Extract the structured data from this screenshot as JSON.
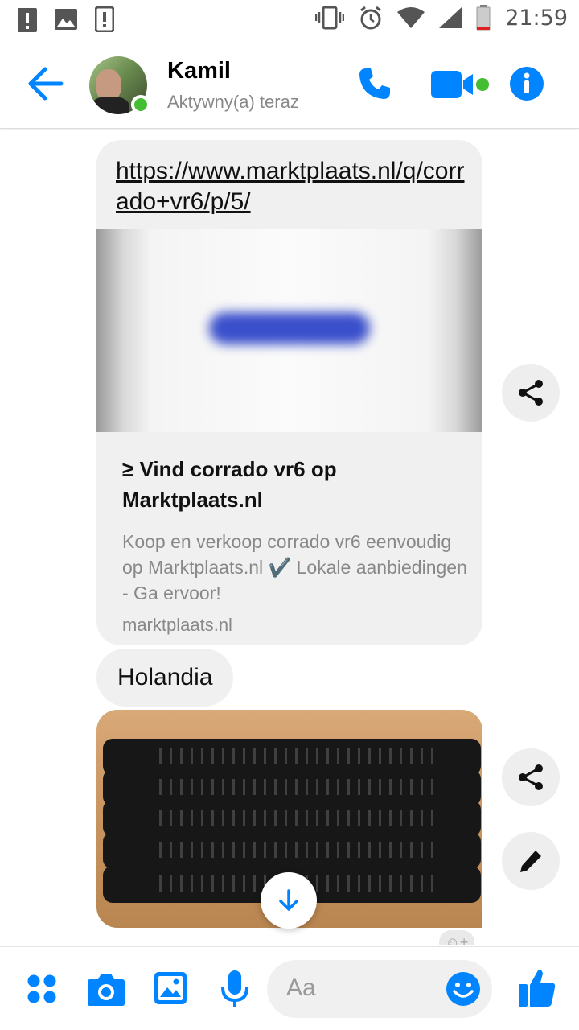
{
  "status_bar": {
    "time": "21:59",
    "left_icons": [
      "alert-icon",
      "image-notification-icon",
      "sim-alert-icon"
    ],
    "right_icons": [
      "vibrate-icon",
      "alarm-icon",
      "wifi-icon",
      "signal-icon",
      "battery-icon"
    ]
  },
  "header": {
    "contact_name": "Kamil",
    "contact_status": "Aktywny(a) teraz",
    "accent_color": "#0084ff",
    "presence_color": "#44bd32",
    "actions": [
      "back-arrow-icon",
      "phone-icon",
      "video-call-icon",
      "info-icon"
    ]
  },
  "chat": {
    "link_card": {
      "url": "https://www.marktplaats.nl/q/corrado+vr6/p/5/",
      "title": "≥ Vind corrado vr6 op Marktplaats.nl",
      "description": "Koop en verkoop corrado vr6 eenvoudig op Marktplaats.nl ✔️ Lokale aanbiedingen - Ga ervoor!",
      "domain": "marktplaats.nl"
    },
    "text_message": "Holandia",
    "photo_description_icon": "car-grilles-photo",
    "side_actions": [
      "share-icon",
      "share-icon",
      "edit-icon"
    ],
    "reaction_button": "add-reaction-icon",
    "scroll_button": "arrow-down-icon"
  },
  "composer": {
    "placeholder": "Aa",
    "icons": [
      "apps-icon",
      "camera-icon",
      "gallery-icon",
      "microphone-icon",
      "emoji-icon",
      "like-icon"
    ]
  }
}
